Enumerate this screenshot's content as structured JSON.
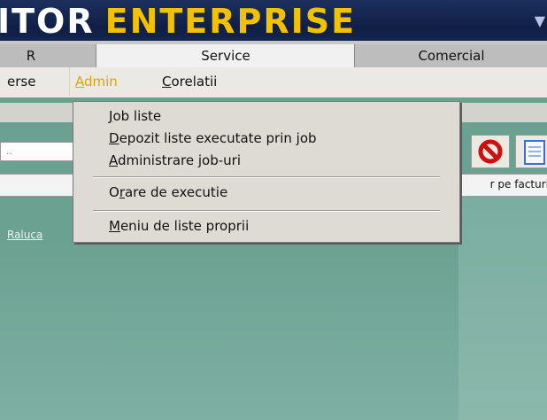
{
  "banner": {
    "part1": "ITOR",
    "part2": "ENTERPRISE",
    "arrow": "▼"
  },
  "tabs": [
    {
      "label": "R"
    },
    {
      "label": "Service"
    },
    {
      "label": "Comercial"
    }
  ],
  "menubar": {
    "items": [
      {
        "label": "erse"
      },
      {
        "accel": "A",
        "rest": "dmin"
      },
      {
        "accel": "C",
        "rest": "orelatii"
      }
    ]
  },
  "toolbar": {
    "combo_value": "..",
    "strip_text": "r pe facturi"
  },
  "content": {
    "user_link": "Raluca"
  },
  "dropdown": {
    "items": [
      {
        "accel": "J",
        "rest": "ob liste"
      },
      {
        "accel": "D",
        "rest": "epozit liste executate prin job"
      },
      {
        "accel": "A",
        "rest": "dministrare job-uri"
      },
      {
        "pre": "O",
        "accel": "r",
        "rest": "are de executie"
      },
      {
        "accel": "M",
        "rest": "eniu de liste proprii"
      }
    ]
  },
  "colors": {
    "brand_white": "#ffffff",
    "brand_yellow": "#f2c200",
    "content_bg": "#6ba191",
    "menu_active": "#d8a800",
    "stop_red": "#cc1010"
  },
  "icons": [
    "dropdown-arrow-icon",
    "stop-icon",
    "document-icon"
  ]
}
